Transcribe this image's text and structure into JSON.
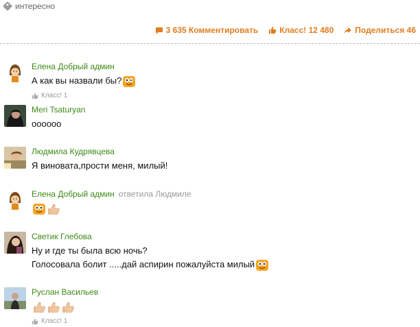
{
  "header": {
    "tag": "интересно",
    "actions": [
      {
        "label": "3 635 Комментировать",
        "icon": "comment-icon"
      },
      {
        "label": "Класс! 12 480",
        "icon": "thumb-up-icon"
      },
      {
        "label": "Поделиться 46",
        "icon": "share-icon"
      }
    ]
  },
  "comments": [
    {
      "author": "Елена Добрый админ",
      "text": "А как вы назвали бы?",
      "like_label": "Класс! 1"
    },
    {
      "author": "Meri Tsaturyan",
      "text": "оооооо"
    },
    {
      "author": "Людмила Кудрявцева",
      "text": "Я виновата,прости меня, милый!"
    },
    {
      "author": "Елена Добрый админ",
      "reply_note": "ответила Людмиле"
    },
    {
      "author": "Светик Глебова",
      "text_line1": "Ну и где ты была всю ночь?",
      "text_line2": "Голосовала болит .....дай аспирин пожалуйста милый"
    },
    {
      "author": "Руслан Васильев",
      "like_label": "Класс! 1"
    }
  ],
  "colors": {
    "accent": "#e07d1d",
    "author": "#3b8a14",
    "muted": "#999999"
  }
}
